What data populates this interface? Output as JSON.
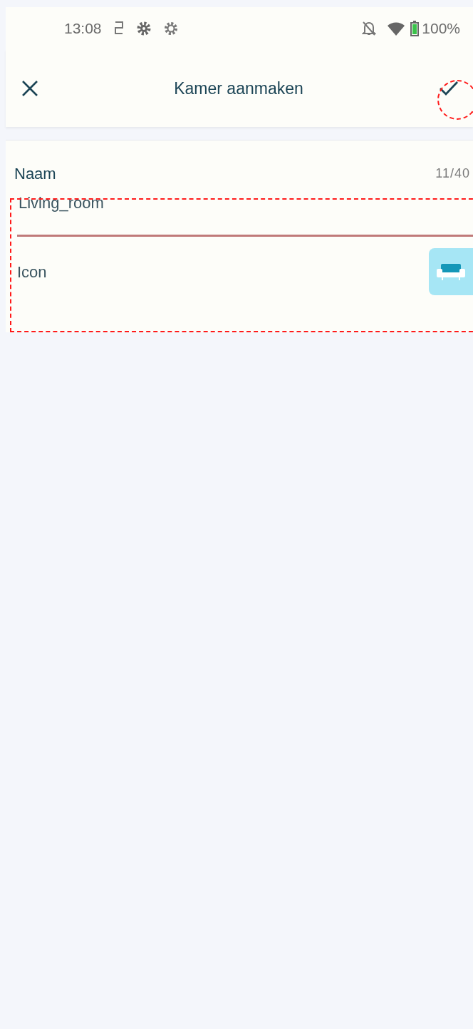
{
  "status_bar": {
    "time": "13:08",
    "battery": "100%"
  },
  "top_bar": {
    "title": "Kamer aanmaken"
  },
  "form": {
    "name_label": "Naam",
    "counter": "11/40",
    "name_value": "Living_room",
    "icon_label": "Icon"
  }
}
